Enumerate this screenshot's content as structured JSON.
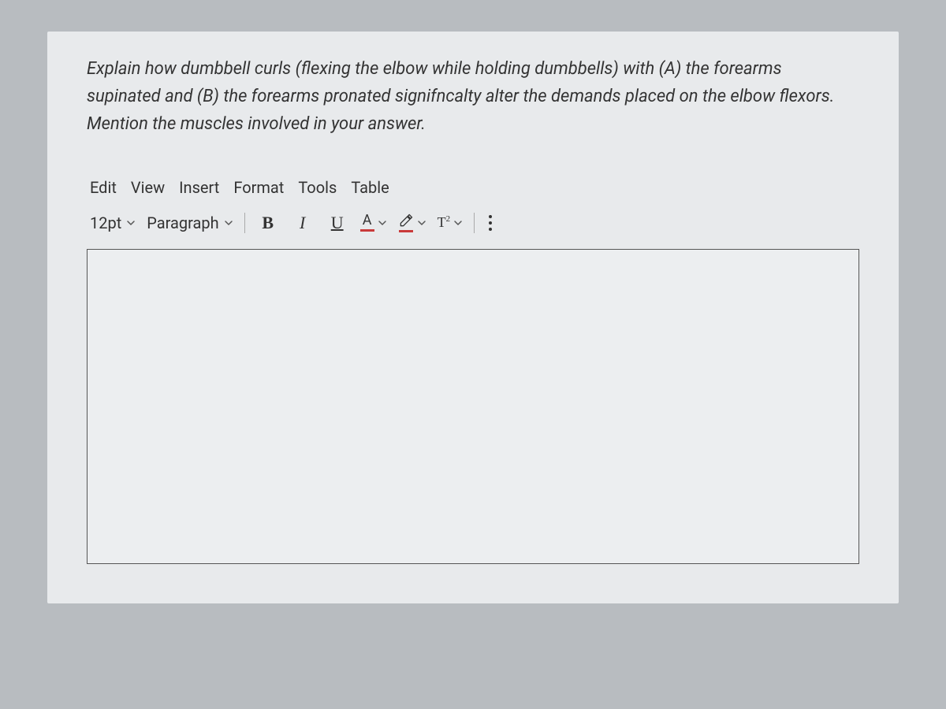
{
  "question": "Explain how dumbbell curls (flexing the elbow while holding dumbbells) with (A) the forearms supinated and (B) the forearms pronated signifncalty alter the demands placed on the elbow flexors.  Mention the muscles involved in your answer.",
  "menubar": {
    "edit": "Edit",
    "view": "View",
    "insert": "Insert",
    "format": "Format",
    "tools": "Tools",
    "table": "Table"
  },
  "toolbar": {
    "font_size": "12pt",
    "style": "Paragraph",
    "bold": "B",
    "italic": "I",
    "underline": "U",
    "text_color_letter": "A",
    "superscript_label": "T",
    "superscript_exp": "2"
  }
}
